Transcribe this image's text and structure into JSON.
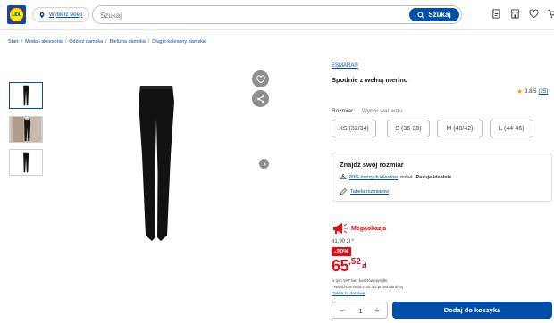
{
  "header": {
    "logo_text": "LIDL",
    "store_label": "Wybierz sklep",
    "search_placeholder": "Szukaj",
    "search_button": "Szukaj",
    "icons": [
      "receipt-icon",
      "store-icon",
      "heart-icon",
      "cart-icon",
      "menu-icon"
    ]
  },
  "breadcrumb": [
    "Start",
    "Moda i akcesoria",
    "Odzież damska",
    "Bielizna damska",
    "Długie kalesony damskie"
  ],
  "gallery": {
    "thumbnails": [
      "leggings-front",
      "model-photo",
      "leggings-back"
    ],
    "active_index": 0
  },
  "product": {
    "brand": "ESMARA®",
    "title": "Spodnie z wełną merino",
    "rating": "3.8/5",
    "rating_count": "(25)",
    "size_label": "Rozmiar:",
    "variant_placeholder": "Wybór wariantu",
    "sizes": [
      "XS (32/34)",
      "S (36-38)",
      "M (40/42)",
      "L (44-46)"
    ]
  },
  "size_finder": {
    "title": "Znajdź swój rozmiar",
    "customers_link": "80% naszych klientów",
    "customers_text": "mówi:",
    "fit_text": "Pasuje idealnie",
    "table_link": "Tabela rozmiarów"
  },
  "pricing": {
    "promo": "Megaokazja",
    "old_price": "81,90 zł *",
    "discount": "-20%",
    "price_main": "65",
    "price_cents": ",52",
    "currency": "zł",
    "vat_note": "w tym VAT bez kosztów wysyłki",
    "lowest_note": "* Najniższa cena z 30 dni przed obniżką",
    "delivery_link": "Opłata za dostawę"
  },
  "cart": {
    "quantity": "1",
    "minus": "−",
    "plus": "+",
    "add_label": "Dodaj do koszyka"
  },
  "colors": {
    "brand_blue": "#0050aa",
    "promo_red": "#e60a14",
    "logo_yellow": "#fff200"
  }
}
